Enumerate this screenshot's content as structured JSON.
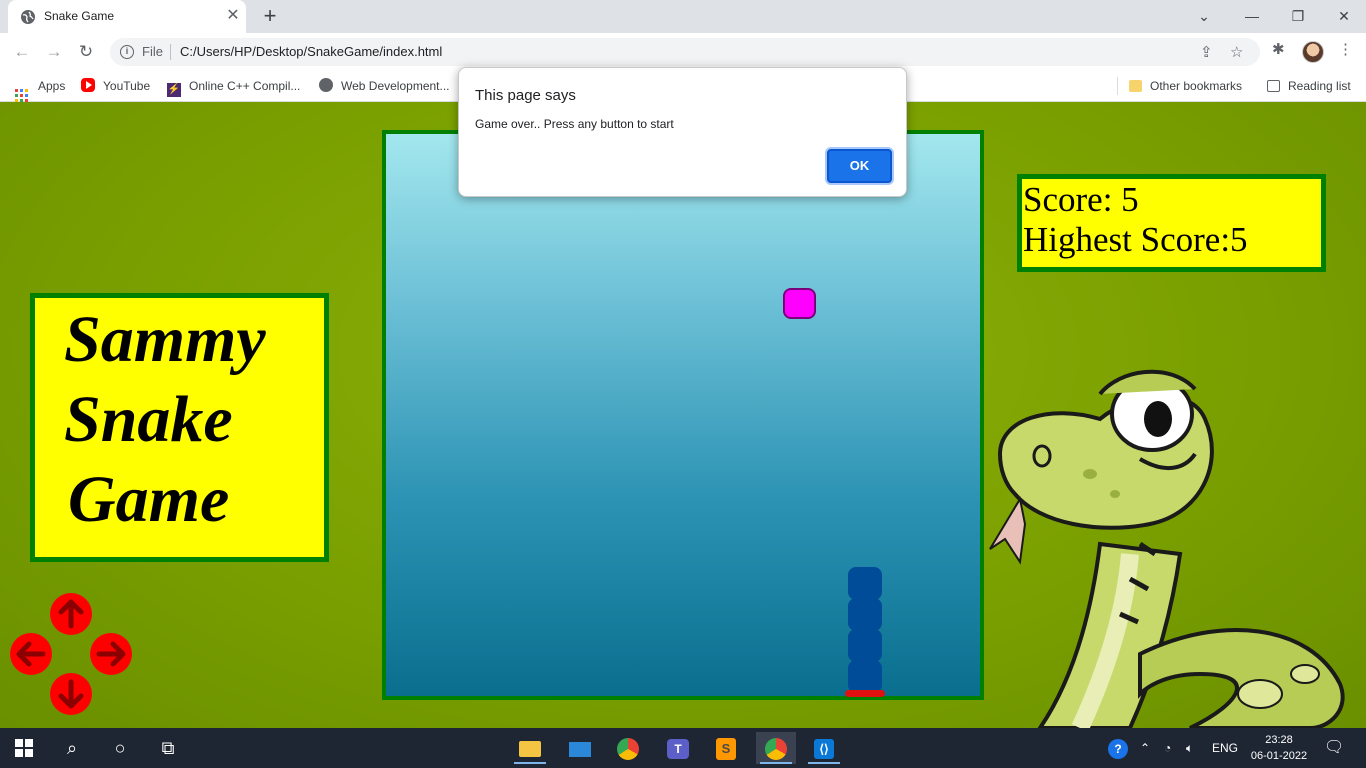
{
  "browser": {
    "tab_title": "Snake Game",
    "tab_close": "✕",
    "new_tab": "+",
    "window_controls": {
      "chevron": "⌄",
      "minimize": "—",
      "restore": "❐",
      "close": "✕"
    },
    "omnibox": {
      "scheme_label": "File",
      "url": "C:/Users/HP/Desktop/SnakeGame/index.html"
    },
    "bookmarks": [
      {
        "label": "Apps",
        "icon": "apps-grid-icon"
      },
      {
        "label": "YouTube",
        "icon": "youtube-icon"
      },
      {
        "label": "Online C++ Compil...",
        "icon": "bolt-icon"
      },
      {
        "label": "Web Development...",
        "icon": "globe-icon"
      }
    ],
    "other_bookmarks": "Other bookmarks",
    "reading_list": "Reading list"
  },
  "game": {
    "title_lines": [
      "Sammy",
      "Snake",
      "Game"
    ],
    "score_label": "Score: 5",
    "highest_label": "Highest Score:5"
  },
  "dialog": {
    "title": "This page says",
    "message": "Game over.. Press any button to start",
    "ok_label": "OK"
  },
  "taskbar": {
    "language": "ENG",
    "time": "23:28",
    "date": "06-01-2022"
  },
  "colors": {
    "page_background": "#7aa000",
    "panel_yellow": "#ffff00",
    "panel_border": "#008000",
    "snake": "#004c99",
    "food": "#ff00ff",
    "controls": "#ff0000"
  }
}
